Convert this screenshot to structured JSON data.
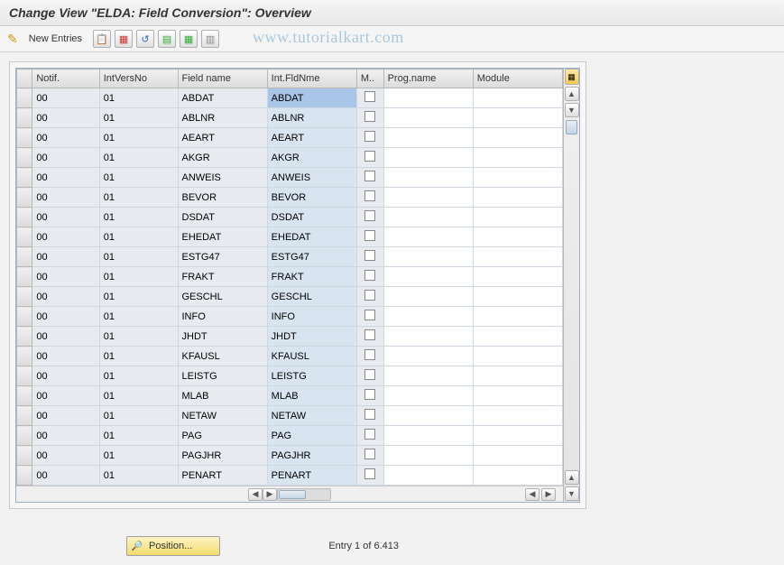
{
  "header": {
    "title": "Change View \"ELDA: Field Conversion\": Overview"
  },
  "toolbar": {
    "new_entries_label": "New Entries",
    "watermark": "www.tutorialkart.com"
  },
  "table": {
    "columns": {
      "notif": "Notif.",
      "intversno": "IntVersNo",
      "fieldname": "Field name",
      "intfldnme": "Int.FldNme",
      "m": "M..",
      "progname": "Prog.name",
      "module": "Module"
    },
    "rows": [
      {
        "notif": "00",
        "intversno": "01",
        "fieldname": "ABDAT",
        "intfldnme": "ABDAT",
        "progname": "",
        "module": "",
        "highlight": true
      },
      {
        "notif": "00",
        "intversno": "01",
        "fieldname": "ABLNR",
        "intfldnme": "ABLNR",
        "progname": "",
        "module": ""
      },
      {
        "notif": "00",
        "intversno": "01",
        "fieldname": "AEART",
        "intfldnme": "AEART",
        "progname": "",
        "module": ""
      },
      {
        "notif": "00",
        "intversno": "01",
        "fieldname": "AKGR",
        "intfldnme": "AKGR",
        "progname": "",
        "module": ""
      },
      {
        "notif": "00",
        "intversno": "01",
        "fieldname": "ANWEIS",
        "intfldnme": "ANWEIS",
        "progname": "",
        "module": ""
      },
      {
        "notif": "00",
        "intversno": "01",
        "fieldname": "BEVOR",
        "intfldnme": "BEVOR",
        "progname": "",
        "module": ""
      },
      {
        "notif": "00",
        "intversno": "01",
        "fieldname": "DSDAT",
        "intfldnme": "DSDAT",
        "progname": "",
        "module": ""
      },
      {
        "notif": "00",
        "intversno": "01",
        "fieldname": "EHEDAT",
        "intfldnme": "EHEDAT",
        "progname": "",
        "module": ""
      },
      {
        "notif": "00",
        "intversno": "01",
        "fieldname": "ESTG47",
        "intfldnme": "ESTG47",
        "progname": "",
        "module": ""
      },
      {
        "notif": "00",
        "intversno": "01",
        "fieldname": "FRAKT",
        "intfldnme": "FRAKT",
        "progname": "",
        "module": ""
      },
      {
        "notif": "00",
        "intversno": "01",
        "fieldname": "GESCHL",
        "intfldnme": "GESCHL",
        "progname": "",
        "module": ""
      },
      {
        "notif": "00",
        "intversno": "01",
        "fieldname": "INFO",
        "intfldnme": "INFO",
        "progname": "",
        "module": ""
      },
      {
        "notif": "00",
        "intversno": "01",
        "fieldname": "JHDT",
        "intfldnme": "JHDT",
        "progname": "",
        "module": ""
      },
      {
        "notif": "00",
        "intversno": "01",
        "fieldname": "KFAUSL",
        "intfldnme": "KFAUSL",
        "progname": "",
        "module": ""
      },
      {
        "notif": "00",
        "intversno": "01",
        "fieldname": "LEISTG",
        "intfldnme": "LEISTG",
        "progname": "",
        "module": ""
      },
      {
        "notif": "00",
        "intversno": "01",
        "fieldname": "MLAB",
        "intfldnme": "MLAB",
        "progname": "",
        "module": ""
      },
      {
        "notif": "00",
        "intversno": "01",
        "fieldname": "NETAW",
        "intfldnme": "NETAW",
        "progname": "",
        "module": ""
      },
      {
        "notif": "00",
        "intversno": "01",
        "fieldname": "PAG",
        "intfldnme": "PAG",
        "progname": "",
        "module": ""
      },
      {
        "notif": "00",
        "intversno": "01",
        "fieldname": "PAGJHR",
        "intfldnme": "PAGJHR",
        "progname": "",
        "module": ""
      },
      {
        "notif": "00",
        "intversno": "01",
        "fieldname": "PENART",
        "intfldnme": "PENART",
        "progname": "",
        "module": ""
      }
    ]
  },
  "footer": {
    "position_label": "Position...",
    "entry_label": "Entry 1 of 6.413"
  }
}
